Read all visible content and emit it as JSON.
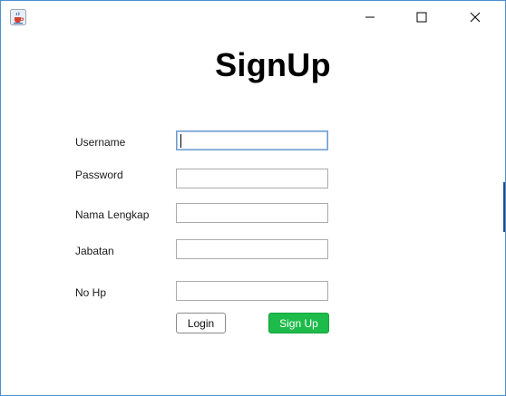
{
  "window": {
    "icon": "java-coffee-cup-icon",
    "controls": {
      "minimize": "minimize-icon",
      "maximize": "maximize-icon",
      "close": "close-icon"
    }
  },
  "form": {
    "title": "SignUp",
    "fields": [
      {
        "label": "Username",
        "value": "",
        "focused": true
      },
      {
        "label": "Password",
        "value": ""
      },
      {
        "label": "Nama Lengkap",
        "value": ""
      },
      {
        "label": "Jabatan",
        "value": ""
      },
      {
        "label": "No Hp",
        "value": ""
      }
    ],
    "buttons": {
      "login": "Login",
      "signup": "Sign Up"
    }
  },
  "colors": {
    "signup_button": "#1dbb4a",
    "window_border": "#4a8fd4",
    "focus_border": "#6e9bd0"
  }
}
